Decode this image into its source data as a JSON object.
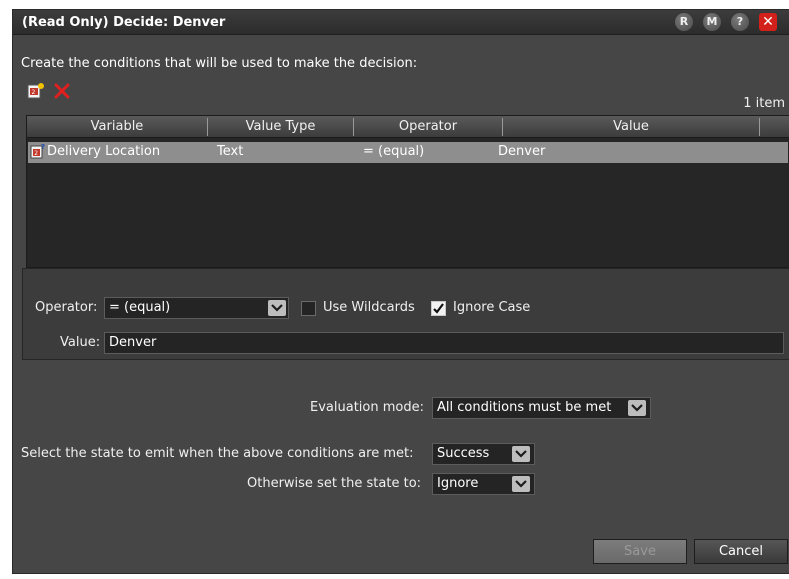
{
  "window": {
    "title": "(Read Only) Decide: Denver",
    "buttons": {
      "r": "R",
      "m": "M",
      "help": "?",
      "close": "✕"
    }
  },
  "prompt": "Create the conditions that will be used to make the decision:",
  "item_count": "1 item",
  "table": {
    "columns": [
      "Variable",
      "Value Type",
      "Operator",
      "Value"
    ],
    "rows": [
      {
        "variable": "Delivery Location",
        "value_type": "Text",
        "operator": "= (equal)",
        "value": "Denver"
      }
    ]
  },
  "condition_editor": {
    "operator_label": "Operator:",
    "operator_value": "= (equal)",
    "use_wildcards_label": "Use Wildcards",
    "use_wildcards_checked": false,
    "ignore_case_label": "Ignore Case",
    "ignore_case_checked": true,
    "value_label": "Value:",
    "value": "Denver"
  },
  "evaluation": {
    "mode_label": "Evaluation mode:",
    "mode_value": "All conditions must be met",
    "emit_label": "Select the state to emit when the above conditions are met:",
    "emit_value": "Success",
    "otherwise_label": "Otherwise set the state to:",
    "otherwise_value": "Ignore"
  },
  "footer": {
    "save": "Save",
    "cancel": "Cancel"
  },
  "colors": {
    "close_red": "#d3201a",
    "dialog_bg": "#464646",
    "selected_row": "#8e8e8e"
  }
}
